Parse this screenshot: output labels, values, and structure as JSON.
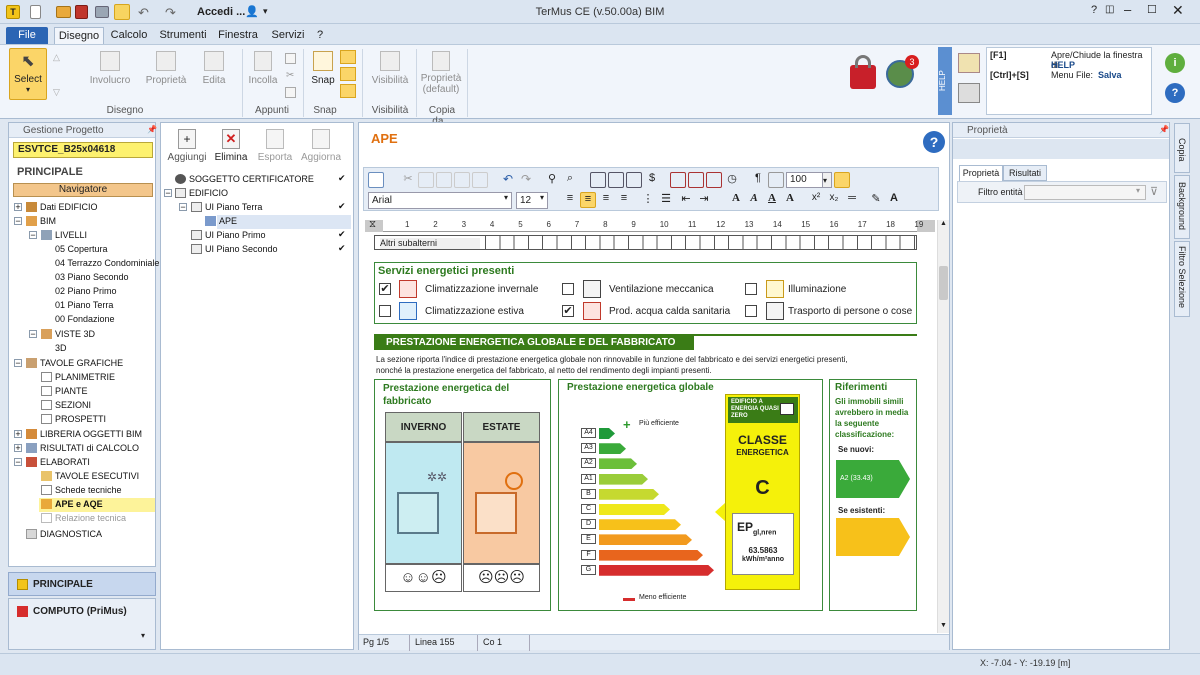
{
  "app": {
    "title": "TerMus CE (v.50.00a) BIM",
    "quick_label": "Accedi ..."
  },
  "tabs": [
    "File",
    "Disegno",
    "Calcolo",
    "Strumenti",
    "Finestra",
    "Servizi",
    "?"
  ],
  "ribbon": {
    "select": "Select",
    "involucro": "Involucro",
    "proprieta": "Proprietà",
    "edita": "Edita",
    "group_disegno": "Disegno",
    "incolla": "Incolla",
    "group_appunti": "Appunti",
    "snap": "Snap",
    "group_snap": "Snap",
    "visibilita": "Visibilità",
    "group_visibilita": "Visibilità",
    "prop_default": "Proprietà (default)",
    "group_copia": "Copia da...",
    "badge": "3"
  },
  "help": {
    "vertical": "HELP",
    "k1": "[F1]",
    "d1": "Apre/Chiude la finestra di",
    "d1b": "HELP",
    "k2": "[Ctrl]+[S]",
    "d2": "Menu File:",
    "d2b": "Salva"
  },
  "left": {
    "title": "Gestione Progetto",
    "project": "ESVTCE_B25x04618",
    "principale": "PRINCIPALE",
    "navigatore": "Navigatore",
    "tree": [
      "Dati EDIFICIO",
      "BIM",
      "LIVELLI",
      "05 Copertura",
      "04 Terrazzo Condominiale",
      "03 Piano Secondo",
      "02 Piano Primo",
      "01 Piano Terra",
      "00 Fondazione",
      "VISTE 3D",
      "3D",
      "TAVOLE GRAFICHE",
      "PLANIMETRIE",
      "PIANTE",
      "SEZIONI",
      "PROSPETTI",
      "LIBRERIA OGGETTI BIM",
      "RISULTATI di CALCOLO",
      "ELABORATI",
      "TAVOLE ESECUTIVI",
      "Schede tecniche",
      "APE e AQE",
      "Relazione tecnica",
      "DIAGNOSTICA"
    ],
    "bottom1": "PRINCIPALE",
    "bottom2": "COMPUTO (PriMus)"
  },
  "mid": {
    "aggiungi": "Aggiungi",
    "elimina": "Elimina",
    "esporta": "Esporta",
    "aggiorna": "Aggiorna",
    "tree": [
      "SOGGETTO CERTIFICATORE",
      "EDIFICIO",
      "UI Piano Terra",
      "APE",
      "UI Piano Primo",
      "UI Piano Secondo"
    ]
  },
  "doc": {
    "title": "APE",
    "font": "Arial",
    "size": "12",
    "zoom": "100",
    "ruler": [
      "1",
      "2",
      "3",
      "4",
      "5",
      "6",
      "7",
      "8",
      "9",
      "10",
      "11",
      "12",
      "13",
      "14",
      "15",
      "16",
      "17",
      "18",
      "19"
    ],
    "altri": "Altri subalterni",
    "servizi_title": "Servizi energetici presenti",
    "servizi": [
      {
        "label": "Climatizzazione invernale",
        "checked": "✔"
      },
      {
        "label": "Climatizzazione estiva",
        "checked": ""
      },
      {
        "label": "Ventilazione meccanica",
        "checked": ""
      },
      {
        "label": "Prod. acqua calda sanitaria",
        "checked": "✔"
      },
      {
        "label": "Illuminazione",
        "checked": ""
      },
      {
        "label": "Trasporto di persone o cose",
        "checked": ""
      }
    ],
    "section_title": "PRESTAZIONE ENERGETICA GLOBALE E DEL FABBRICATO",
    "desc1": "La sezione riporta l'indice di prestazione energetica globale non rinnovabile in funzione del fabbricato e dei servizi energetici presenti,",
    "desc2": "nonché la prestazione energetica del fabbricato, al netto del rendimento degli impianti presenti.",
    "fabbricato_title": "Prestazione energetica del fabbricato",
    "inverno": "INVERNO",
    "estate": "ESTATE",
    "globale_title": "Prestazione energetica globale",
    "piu": "Più efficiente",
    "meno": "Meno efficiente",
    "classes": [
      "A4",
      "A3",
      "A2",
      "A1",
      "B",
      "C",
      "D",
      "E",
      "F",
      "G"
    ],
    "nzeb": "EDIFICIO A ENERGIA QUASI ZERO",
    "classe": "CLASSE",
    "energetica": "ENERGETICA",
    "classe_val": "C",
    "ep": "EP",
    "ep_sub": "gl,nren",
    "ep_val": "63.5863",
    "ep_unit": "kWh/m²anno",
    "rif_title": "Riferimenti",
    "rif_desc": "Gli immobili simili avrebbero in media la seguente classificazione:",
    "nuovi": "Se nuovi:",
    "nuovi_val": "A2 (33.43)",
    "esistenti": "Se esistenti:"
  },
  "status": {
    "pg": "Pg 1/5",
    "linea": "Linea 155",
    "col": "Co 1",
    "coords": "X: -7.04 - Y: -19.19 [m]"
  },
  "right": {
    "title": "Proprietà",
    "tab1": "Proprietà",
    "tab2": "Risultati",
    "filtro": "Filtro entità",
    "side": [
      "Copia",
      "Background",
      "Filtro Selezione"
    ]
  },
  "colors": {
    "green_dark": "#2d7a1f",
    "band_title": "#3a7c16",
    "class_yellow": "#f5f10a"
  }
}
